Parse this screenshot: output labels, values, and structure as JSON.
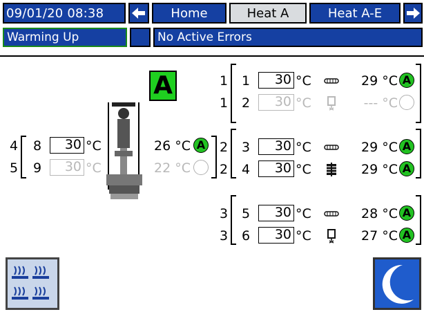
{
  "header": {
    "datetime": "09/01/20 08:38",
    "tabs": [
      {
        "label": "Home"
      },
      {
        "label": "Heat A"
      },
      {
        "label": "Heat A-E"
      }
    ]
  },
  "status": {
    "state": "Warming Up",
    "errors": "No Active Errors"
  },
  "zone_label": "A",
  "unit": "°C",
  "right_zones": [
    {
      "group": "1",
      "zone": "1",
      "setpoint": "30",
      "actual": "29 °C",
      "led": "A",
      "enabled": true,
      "icon": "hose-icon"
    },
    {
      "group": "1",
      "zone": "2",
      "setpoint": "30",
      "actual": "--- °C",
      "led": "",
      "enabled": false,
      "icon": "heater-icon"
    },
    {
      "group": "2",
      "zone": "3",
      "setpoint": "30",
      "actual": "29 °C",
      "led": "A",
      "enabled": true,
      "icon": "hose-icon"
    },
    {
      "group": "2",
      "zone": "4",
      "setpoint": "30",
      "actual": "29 °C",
      "led": "A",
      "enabled": true,
      "icon": "manifold-icon"
    },
    {
      "group": "3",
      "zone": "5",
      "setpoint": "30",
      "actual": "28 °C",
      "led": "A",
      "enabled": true,
      "icon": "hose-icon"
    },
    {
      "group": "3",
      "zone": "6",
      "setpoint": "30",
      "actual": "27 °C",
      "led": "A",
      "enabled": true,
      "icon": "heater-icon"
    }
  ],
  "left_zones": [
    {
      "group": "4",
      "zone": "8",
      "setpoint": "30",
      "actual": "26 °C",
      "led": "A",
      "enabled": true
    },
    {
      "group": "5",
      "zone": "9",
      "setpoint": "30",
      "actual": "22 °C",
      "led": "",
      "enabled": false
    }
  ],
  "buttons": {
    "heat_icon": "heat-zones-icon",
    "sleep_icon": "moon-icon"
  },
  "colors": {
    "header_blue": "#1540a2",
    "active_tab": "#d9dcdf",
    "led_green": "#22c222",
    "zone_green": "#1fd020",
    "sleep_blue": "#1f5ccc"
  }
}
